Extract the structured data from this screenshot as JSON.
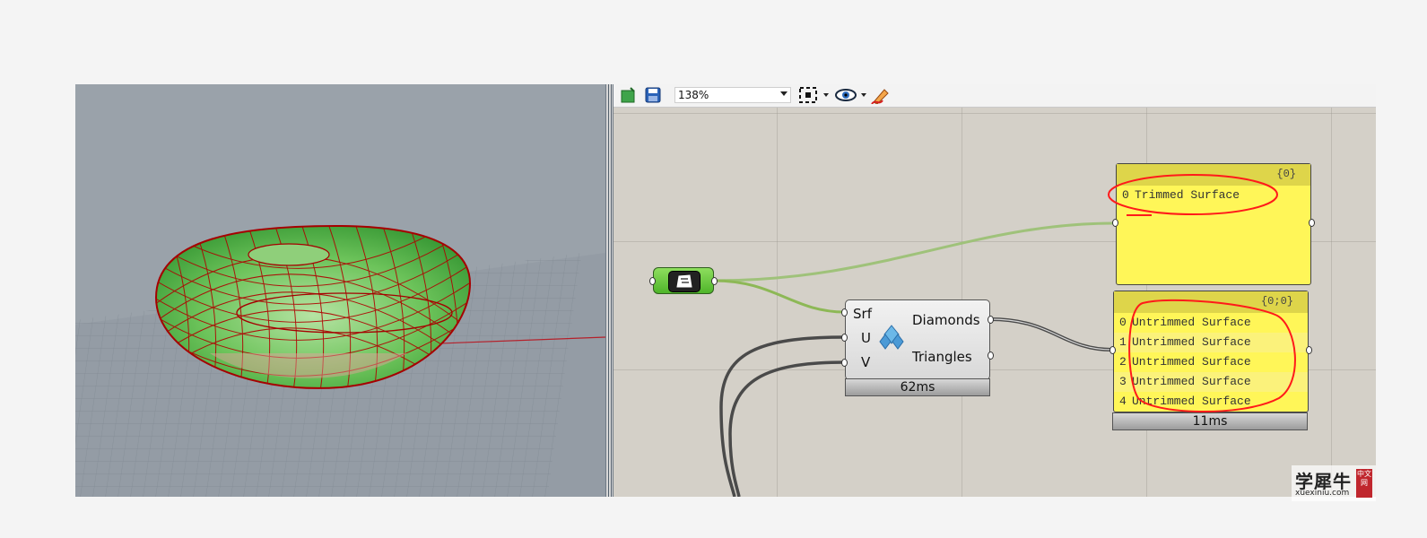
{
  "toolbar": {
    "zoom_value": "138%",
    "icons": [
      "new-document-icon",
      "save-icon",
      "zoom-extents-icon",
      "preview-eye-icon",
      "sketch-pen-icon"
    ]
  },
  "components": {
    "diamond_panels": {
      "inputs": [
        "Srf",
        "U",
        "V"
      ],
      "outputs": [
        "Diamonds",
        "Triangles"
      ],
      "timer": "62ms"
    },
    "panel_top": {
      "path": "{0}",
      "rows": [
        {
          "index": "0",
          "text": "Trimmed Surface"
        }
      ]
    },
    "panel_bottom": {
      "path": "{0;0}",
      "rows": [
        {
          "index": "0",
          "text": "Untrimmed Surface"
        },
        {
          "index": "1",
          "text": "Untrimmed Surface"
        },
        {
          "index": "2",
          "text": "Untrimmed Surface"
        },
        {
          "index": "3",
          "text": "Untrimmed Surface"
        },
        {
          "index": "4",
          "text": "Untrimmed Surface"
        }
      ],
      "timer": "11ms"
    }
  },
  "watermark": {
    "title": "学犀牛",
    "url": "xuexiniu.com",
    "badge": "中文网"
  },
  "colors": {
    "viewport_bg": "#9aa2aa",
    "mesh_red": "#b00000",
    "surface_green": "#5fbf4a",
    "panel_yellow": "#fff658",
    "annotation_red": "#ff1a1a"
  }
}
